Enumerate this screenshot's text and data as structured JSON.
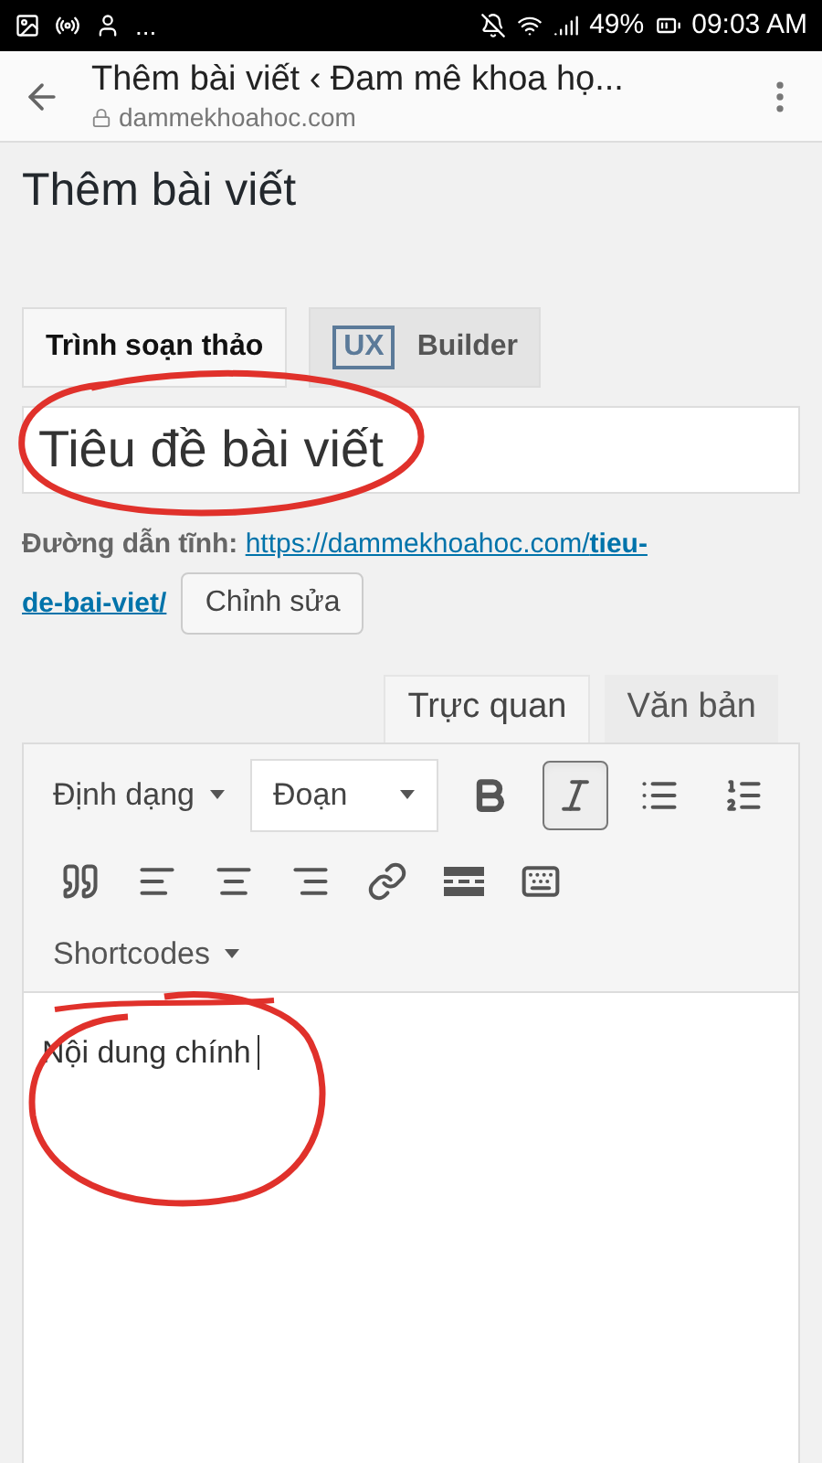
{
  "status_bar": {
    "notifications": "...",
    "battery": "49%",
    "time": "09:03 AM"
  },
  "browser": {
    "title": "Thêm bài viết ‹ Đam mê khoa họ...",
    "url": "dammekhoahoc.com"
  },
  "page_title": "Thêm bài viết",
  "editor_modes": [
    {
      "label": "Trình soạn thảo",
      "selected": true,
      "kind": "text"
    },
    {
      "label": "Builder",
      "badge": "UX",
      "selected": false,
      "kind": "badge"
    }
  ],
  "title_field": {
    "value": "Tiêu đề bài viết"
  },
  "permalink": {
    "label": "Đường dẫn tĩnh:",
    "url_base": "https://dammekhoahoc.com/",
    "slug_part1": "tieu-",
    "slug_part2": "de-bai-viet/",
    "edit_button": "Chỉnh sửa"
  },
  "content_tabs": [
    {
      "label": "Trực quan",
      "selected": true
    },
    {
      "label": "Văn bản",
      "selected": false
    }
  ],
  "toolbar_row1": [
    {
      "kind": "menu",
      "label": "Định dạng"
    },
    {
      "kind": "select",
      "value": "Đoạn"
    },
    {
      "kind": "button",
      "active": false
    },
    {
      "kind": "button",
      "active": true
    },
    {
      "kind": "button",
      "active": false
    },
    {
      "kind": "button",
      "active": false
    }
  ],
  "toolbar_row2": [
    {
      "kind": "button",
      "active": false
    },
    {
      "kind": "button",
      "active": false
    },
    {
      "kind": "button",
      "active": false
    },
    {
      "kind": "button",
      "active": false
    },
    {
      "kind": "button",
      "active": false
    },
    {
      "kind": "button",
      "active": false
    },
    {
      "kind": "button",
      "active": false
    }
  ],
  "shortcodes": {
    "label": "Shortcodes"
  },
  "content": {
    "value": "Nội dung chính"
  }
}
